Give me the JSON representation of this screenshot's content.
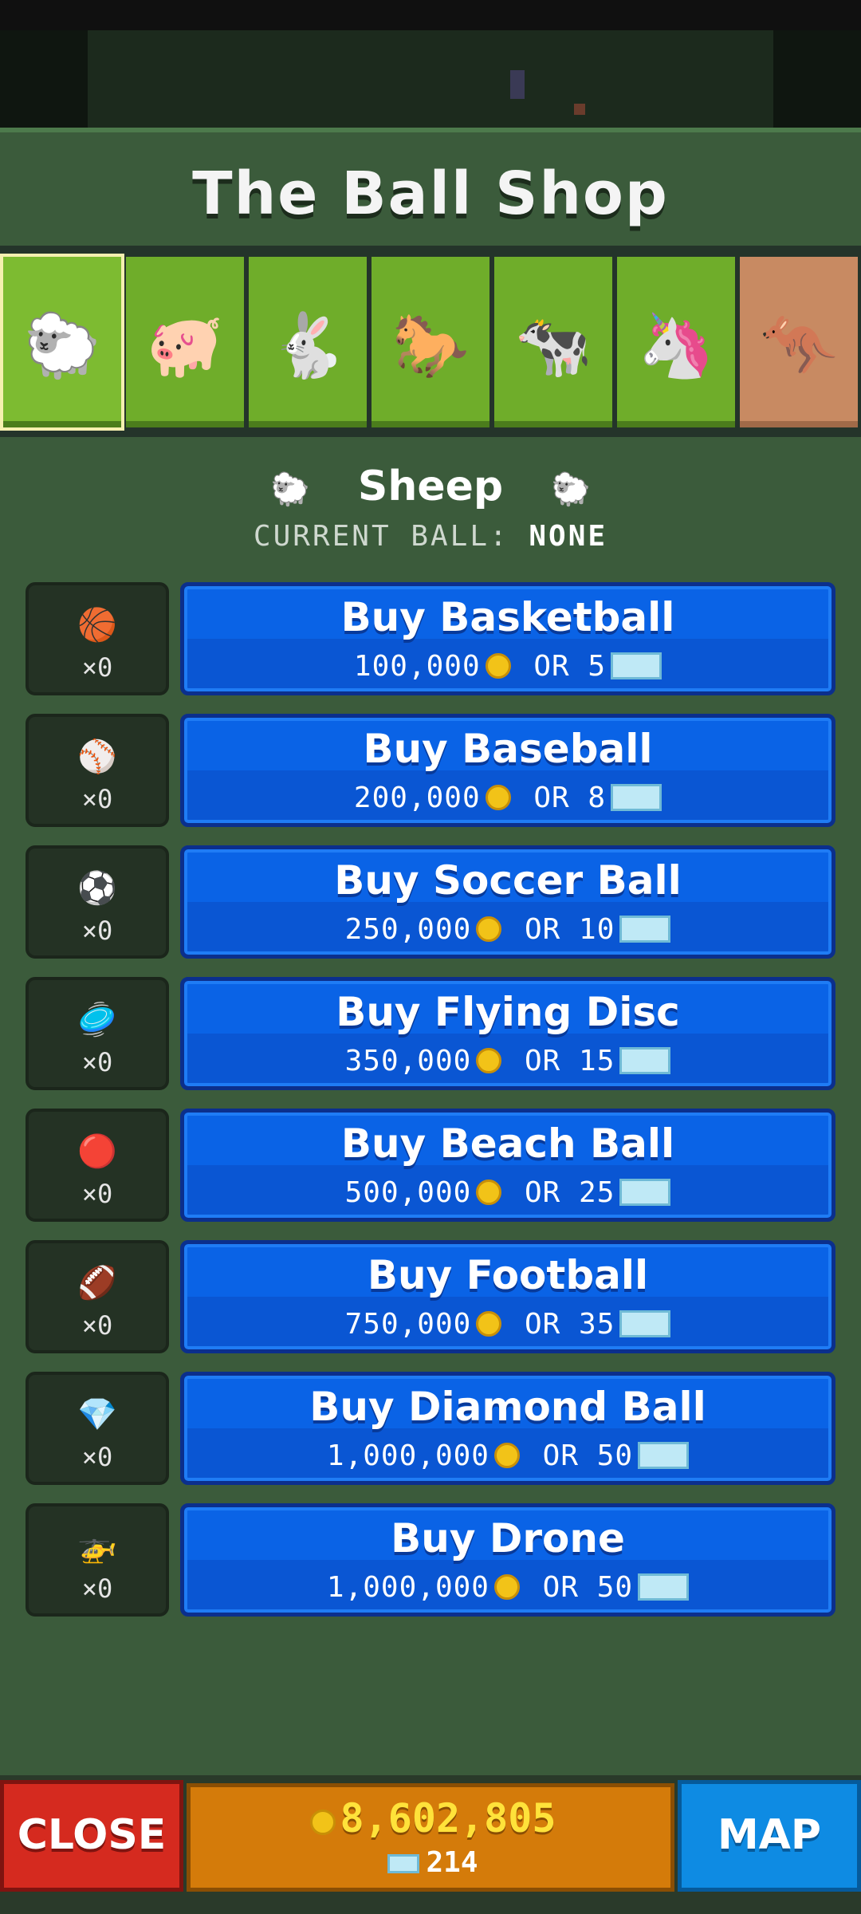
{
  "title": "The Ball Shop",
  "tabs": [
    {
      "name": "sheep",
      "icon": "🐑",
      "selected": true
    },
    {
      "name": "pig",
      "icon": "🐖",
      "selected": false
    },
    {
      "name": "rabbit",
      "icon": "🐇",
      "selected": false
    },
    {
      "name": "horse",
      "icon": "🐎",
      "selected": false
    },
    {
      "name": "cow",
      "icon": "🐄",
      "selected": false
    },
    {
      "name": "unicorn",
      "icon": "🦄",
      "selected": false
    },
    {
      "name": "kangaroo",
      "icon": "🦘",
      "selected": false
    }
  ],
  "animal": {
    "name": "Sheep",
    "icon": "🐑"
  },
  "current_ball": {
    "label": "CURRENT BALL: ",
    "value": "NONE"
  },
  "items": [
    {
      "icon": "🏀",
      "count": "×0",
      "label": "Buy Basketball",
      "coins": "100,000",
      "or": "OR",
      "gems": "5"
    },
    {
      "icon": "⚾",
      "count": "×0",
      "label": "Buy Baseball",
      "coins": "200,000",
      "or": "OR",
      "gems": "8"
    },
    {
      "icon": "⚽",
      "count": "×0",
      "label": "Buy Soccer Ball",
      "coins": "250,000",
      "or": "OR",
      "gems": "10"
    },
    {
      "icon": "🥏",
      "count": "×0",
      "label": "Buy Flying Disc",
      "coins": "350,000",
      "or": "OR",
      "gems": "15"
    },
    {
      "icon": "🔴",
      "count": "×0",
      "label": "Buy Beach Ball",
      "coins": "500,000",
      "or": "OR",
      "gems": "25"
    },
    {
      "icon": "🏈",
      "count": "×0",
      "label": "Buy Football",
      "coins": "750,000",
      "or": "OR",
      "gems": "35"
    },
    {
      "icon": "💎",
      "count": "×0",
      "label": "Buy Diamond Ball",
      "coins": "1,000,000",
      "or": "OR",
      "gems": "50"
    },
    {
      "icon": "🚁",
      "count": "×0",
      "label": "Buy Drone",
      "coins": "1,000,000",
      "or": "OR",
      "gems": "50"
    }
  ],
  "footer": {
    "close": "CLOSE",
    "coins": "8,602,805",
    "gems": "214",
    "map": "MAP"
  },
  "colors": {
    "panel": "#3b5b3b",
    "button_blue": "#0a63e6",
    "close_red": "#d52a1f",
    "map_blue": "#0e8be3",
    "currency_orange": "#d47b0a"
  }
}
